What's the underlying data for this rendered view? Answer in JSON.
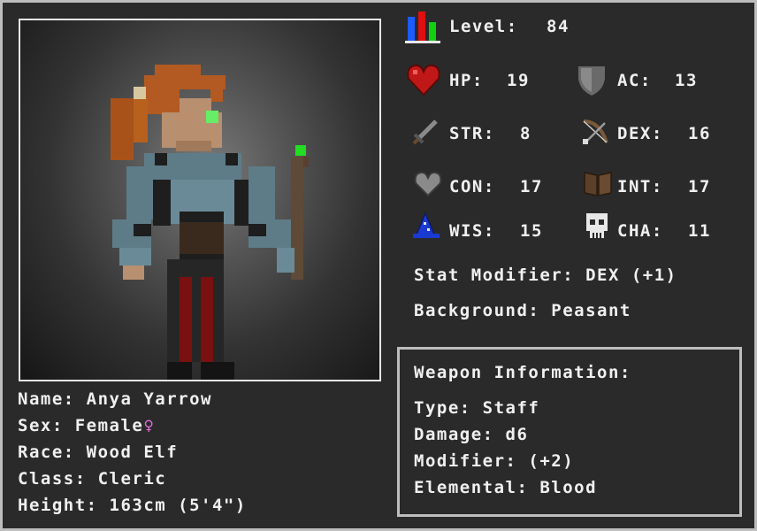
{
  "level": {
    "label": "Level:",
    "value": "84"
  },
  "stats": {
    "hp": {
      "label": "HP:",
      "value": "19"
    },
    "ac": {
      "label": "AC:",
      "value": "13"
    },
    "str": {
      "label": "STR:",
      "value": "8"
    },
    "dex": {
      "label": "DEX:",
      "value": "16"
    },
    "con": {
      "label": "CON:",
      "value": "17"
    },
    "int": {
      "label": "INT:",
      "value": "17"
    },
    "wis": {
      "label": "WIS:",
      "value": "15"
    },
    "cha": {
      "label": "CHA:",
      "value": "11"
    }
  },
  "stat_modifier": "Stat Modifier: DEX (+1)",
  "background": "Background: Peasant",
  "character": {
    "name": "Name: Anya Yarrow",
    "sex": "Sex: Female",
    "sex_symbol": "♀",
    "race": "Race: Wood Elf",
    "class": "Class: Cleric",
    "height": "Height: 163cm (5'4\")"
  },
  "weapon": {
    "title": "Weapon Information:",
    "type": "Type: Staff",
    "damage": "Damage: d6",
    "modifier": "Modifier: (+2)",
    "elemental": "Elemental: Blood"
  },
  "icons": {
    "level": "stat-bars-icon",
    "hp": "heart-icon",
    "ac": "shield-icon",
    "str": "sword-icon",
    "dex": "bow-icon",
    "con": "grey-heart-icon",
    "int": "book-icon",
    "wis": "wizard-hat-icon",
    "cha": "skull-icon"
  },
  "colors": {
    "background": "#2a2a2a",
    "border": "#bdbdbd",
    "text": "#f0f0f0",
    "female_symbol": "#e070e0"
  }
}
